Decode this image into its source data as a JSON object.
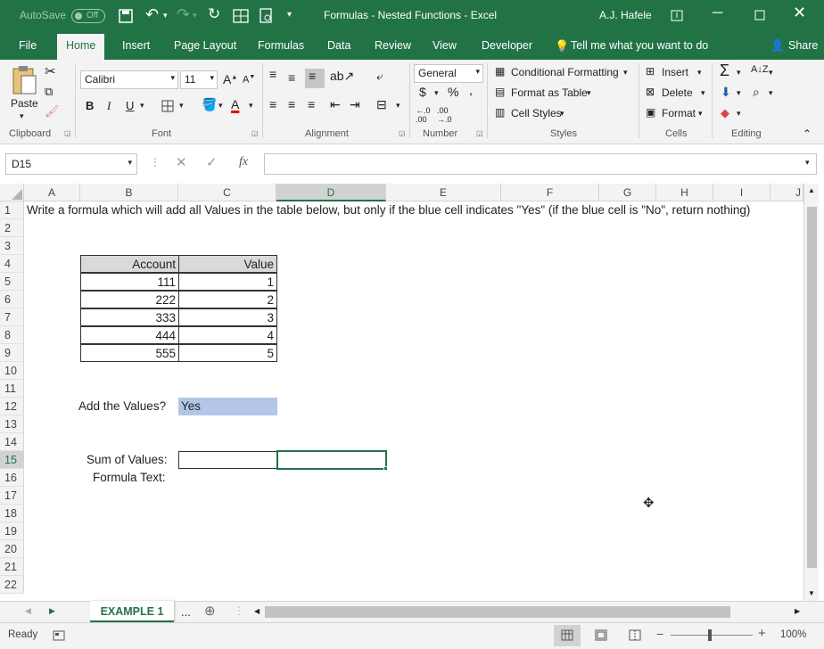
{
  "titlebar": {
    "autosave": "AutoSave",
    "autosave_state": "Off",
    "title": "Formulas - Nested Functions  -  Excel",
    "user": "A.J. Hafele"
  },
  "tabs": [
    "File",
    "Home",
    "Insert",
    "Page Layout",
    "Formulas",
    "Data",
    "Review",
    "View",
    "Developer"
  ],
  "tell_me": "Tell me what you want to do",
  "share": "Share",
  "ribbon": {
    "paste": "Paste",
    "font_name": "Calibri",
    "font_size": "11",
    "number_format": "General",
    "conditional_formatting": "Conditional Formatting",
    "format_as_table": "Format as Table",
    "cell_styles": "Cell Styles",
    "insert": "Insert",
    "delete": "Delete",
    "format": "Format",
    "groups": {
      "clipboard": "Clipboard",
      "font": "Font",
      "alignment": "Alignment",
      "number": "Number",
      "styles": "Styles",
      "cells": "Cells",
      "editing": "Editing"
    }
  },
  "namebox": "D15",
  "fx": "fx",
  "columns": [
    "A",
    "B",
    "C",
    "D",
    "E",
    "F",
    "G",
    "H",
    "I",
    "J"
  ],
  "rows": [
    "1",
    "2",
    "3",
    "4",
    "5",
    "6",
    "7",
    "8",
    "9",
    "10",
    "11",
    "12",
    "13",
    "14",
    "15",
    "16",
    "17",
    "18",
    "19",
    "20",
    "21",
    "22"
  ],
  "sheet": {
    "instruction": "Write a formula which will add all Values in the table below, but only if the blue cell indicates \"Yes\" (if the blue cell is \"No\", return nothing)",
    "table_header": [
      "Account",
      "Value"
    ],
    "table_rows": [
      [
        "111",
        "1"
      ],
      [
        "222",
        "2"
      ],
      [
        "333",
        "3"
      ],
      [
        "444",
        "4"
      ],
      [
        "555",
        "5"
      ]
    ],
    "add_values_label": "Add the Values?",
    "add_values_answer": "Yes",
    "sum_label": "Sum of Values:",
    "formula_label": "Formula Text:"
  },
  "sheet_tab": "EXAMPLE 1",
  "sheet_more": "...",
  "status": {
    "ready": "Ready",
    "zoom": "100%"
  },
  "colors": {
    "excel_green": "#217346",
    "blue_cell": "#b4c6e7"
  }
}
